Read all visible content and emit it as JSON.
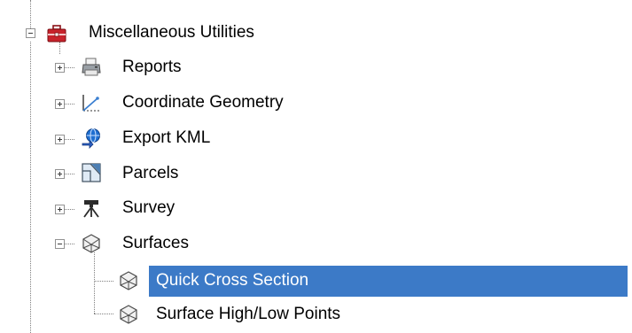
{
  "tree": {
    "root": {
      "label": "Miscellaneous Utilities",
      "icon": "toolbox-icon",
      "expanded": true
    },
    "children": [
      {
        "label": "Reports",
        "icon": "printer-icon",
        "expanded": false
      },
      {
        "label": "Coordinate Geometry",
        "icon": "cogo-icon",
        "expanded": false
      },
      {
        "label": "Export KML",
        "icon": "globe-export-icon",
        "expanded": false
      },
      {
        "label": "Parcels",
        "icon": "parcel-map-icon",
        "expanded": false
      },
      {
        "label": "Survey",
        "icon": "survey-tripod-icon",
        "expanded": false
      },
      {
        "label": "Surfaces",
        "icon": "surface-icon",
        "expanded": true
      }
    ],
    "surfaces_children": [
      {
        "label": "Quick Cross Section",
        "icon": "surface-icon",
        "selected": true
      },
      {
        "label": "Surface High/Low Points",
        "icon": "surface-icon",
        "selected": false
      }
    ]
  },
  "colors": {
    "selection": "#3c7ac7",
    "toolbox": "#c8232c",
    "globe": "#1f6fd1",
    "connector": "#7f7f7f"
  }
}
